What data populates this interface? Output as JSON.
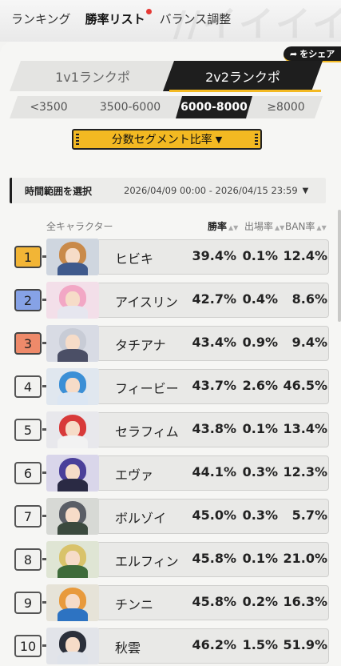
{
  "nav": {
    "tabs": [
      {
        "label": "ランキング"
      },
      {
        "label": "勝率リスト"
      },
      {
        "label": "バランス調整"
      }
    ]
  },
  "share": {
    "label": "をシェア"
  },
  "modes": [
    {
      "label": "1v1ランクポ"
    },
    {
      "label": "2v2ランクポ"
    }
  ],
  "score_tabs": [
    {
      "label": "<3500"
    },
    {
      "label": "3500-6000"
    },
    {
      "label": "6000-8000"
    },
    {
      "label": "≥8000"
    }
  ],
  "segment_button": {
    "label": "分数セグメント比率",
    "caret": "▼"
  },
  "time_range": {
    "label": "時間範囲を選択",
    "value": "2026/04/09 00:00 - 2026/04/15 23:59",
    "caret": "▼"
  },
  "table": {
    "header": {
      "all": "全キャラクター",
      "win": "勝率",
      "pick": "出場率",
      "ban": "BAN率"
    },
    "rows": [
      {
        "rank": "1",
        "name": "ヒビキ",
        "win": "39.4%",
        "pick": "0.1%",
        "ban": "12.4%",
        "hair": "#c98a4a",
        "body": "#3f5a8c",
        "bg": "#cfd6df"
      },
      {
        "rank": "2",
        "name": "アイスリン",
        "win": "42.7%",
        "pick": "0.4%",
        "ban": "8.6%",
        "hair": "#f2a7c5",
        "body": "#e6e6ef",
        "bg": "#f3dfe9"
      },
      {
        "rank": "3",
        "name": "タチアナ",
        "win": "43.4%",
        "pick": "0.9%",
        "ban": "9.4%",
        "hair": "#c8ccd6",
        "body": "#4b4f66",
        "bg": "#d8dbe4"
      },
      {
        "rank": "4",
        "name": "フィービー",
        "win": "43.7%",
        "pick": "2.6%",
        "ban": "46.5%",
        "hair": "#3b8fd6",
        "body": "#dbe6f3",
        "bg": "#e0e7ef"
      },
      {
        "rank": "5",
        "name": "セラフィム",
        "win": "43.8%",
        "pick": "0.1%",
        "ban": "13.4%",
        "hair": "#d83a3a",
        "body": "#f2f2f2",
        "bg": "#e8e8ec"
      },
      {
        "rank": "6",
        "name": "エヴァ",
        "win": "44.1%",
        "pick": "0.3%",
        "ban": "12.3%",
        "hair": "#4a3f9a",
        "body": "#2a2a44",
        "bg": "#d9d6ea"
      },
      {
        "rank": "7",
        "name": "ボルゾイ",
        "win": "45.0%",
        "pick": "0.3%",
        "ban": "5.7%",
        "hair": "#5a5e66",
        "body": "#3b4a3e",
        "bg": "#d7d9d5"
      },
      {
        "rank": "8",
        "name": "エルフィン",
        "win": "45.8%",
        "pick": "0.1%",
        "ban": "21.0%",
        "hair": "#d9c36a",
        "body": "#3e6b3a",
        "bg": "#dfe5d4"
      },
      {
        "rank": "9",
        "name": "チンニ",
        "win": "45.8%",
        "pick": "0.2%",
        "ban": "16.3%",
        "hair": "#e89a3c",
        "body": "#2d73c2",
        "bg": "#e6e3d8"
      },
      {
        "rank": "10",
        "name": "秋雲",
        "win": "46.2%",
        "pick": "1.5%",
        "ban": "51.9%",
        "hair": "#2a2f3a",
        "body": "#dfe3ea",
        "bg": "#e2e4e9"
      }
    ]
  },
  "colors": {
    "accent": "#f3b922",
    "dark": "#1e1e1e",
    "gold": "#f2b536",
    "silver": "#86a2e6",
    "bronze": "#ee8a6a"
  }
}
